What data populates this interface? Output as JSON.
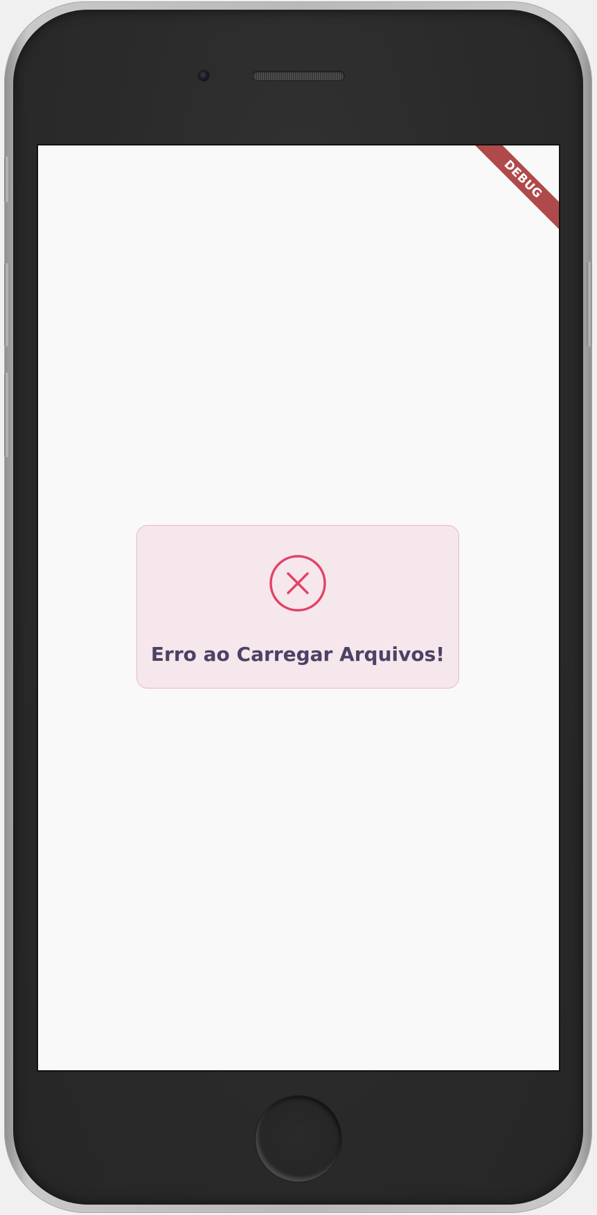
{
  "app": {
    "debug_banner": "DEBUG"
  },
  "error_card": {
    "message": "Erro ao Carregar Arquivos!",
    "icon": "close-circle-icon",
    "icon_color": "#e34266",
    "background_color": "#f5e7eb",
    "border_color": "#e9b7c6",
    "text_color": "#4c4266"
  },
  "device": {
    "home_button_icon": "home-button"
  }
}
